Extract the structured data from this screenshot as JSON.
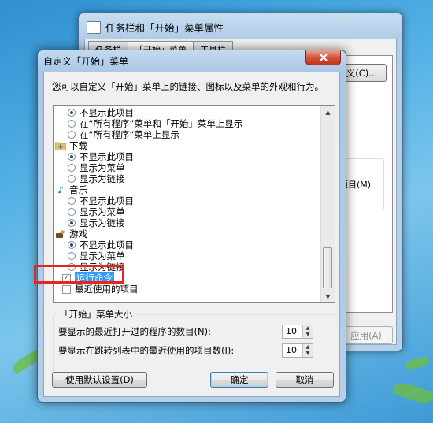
{
  "background_window": {
    "title": "任务栏和「开始」菜单属性",
    "tabs": [
      "任务栏",
      "「开始」菜单",
      "工具栏"
    ],
    "customize_button": "自定义(C)...",
    "truncated_label": "项目(M)",
    "apply_button": "应用(A)"
  },
  "dialog": {
    "title": "自定义「开始」菜单",
    "description": "您可以自定义「开始」菜单上的链接、图标以及菜单的外观和行为。",
    "list": {
      "pre_items": [
        {
          "label": "不显示此项目",
          "checked": true
        },
        {
          "label": "在“所有程序”菜单和「开始」菜单上显示",
          "checked": false
        },
        {
          "label": "在“所有程序”菜单上显示",
          "checked": false
        }
      ],
      "groups": [
        {
          "label": "下载",
          "icon": "folder-icon",
          "options": [
            {
              "label": "不显示此项目",
              "checked": true
            },
            {
              "label": "显示为菜单",
              "checked": false
            },
            {
              "label": "显示为链接",
              "checked": false
            }
          ]
        },
        {
          "label": "音乐",
          "icon": "music-note-icon",
          "options": [
            {
              "label": "不显示此项目",
              "checked": false
            },
            {
              "label": "显示为菜单",
              "checked": false
            },
            {
              "label": "显示为链接",
              "checked": true
            }
          ]
        },
        {
          "label": "游戏",
          "icon": "games-icon",
          "options": [
            {
              "label": "不显示此项目",
              "checked": true
            },
            {
              "label": "显示为菜单",
              "checked": false
            },
            {
              "label": "显示为链接",
              "checked": false
            }
          ]
        }
      ],
      "run_command": {
        "label": "运行命令",
        "checked": true,
        "selected": true
      },
      "recent_items": {
        "label": "最近使用的项目",
        "checked": false
      }
    },
    "size_group": {
      "title": "「开始」菜单大小",
      "recent_programs_label": "要显示的最近打开过的程序的数目(N):",
      "recent_programs_value": "10",
      "jump_list_label": "要显示在跳转列表中的最近使用的项目数(I):",
      "jump_list_value": "10"
    },
    "buttons": {
      "defaults": "使用默认设置(D)",
      "ok": "确定",
      "cancel": "取消"
    }
  },
  "colors": {
    "highlight": "#3399ff",
    "annotation_box": "#e8241c",
    "close_button": "#c4331a"
  }
}
